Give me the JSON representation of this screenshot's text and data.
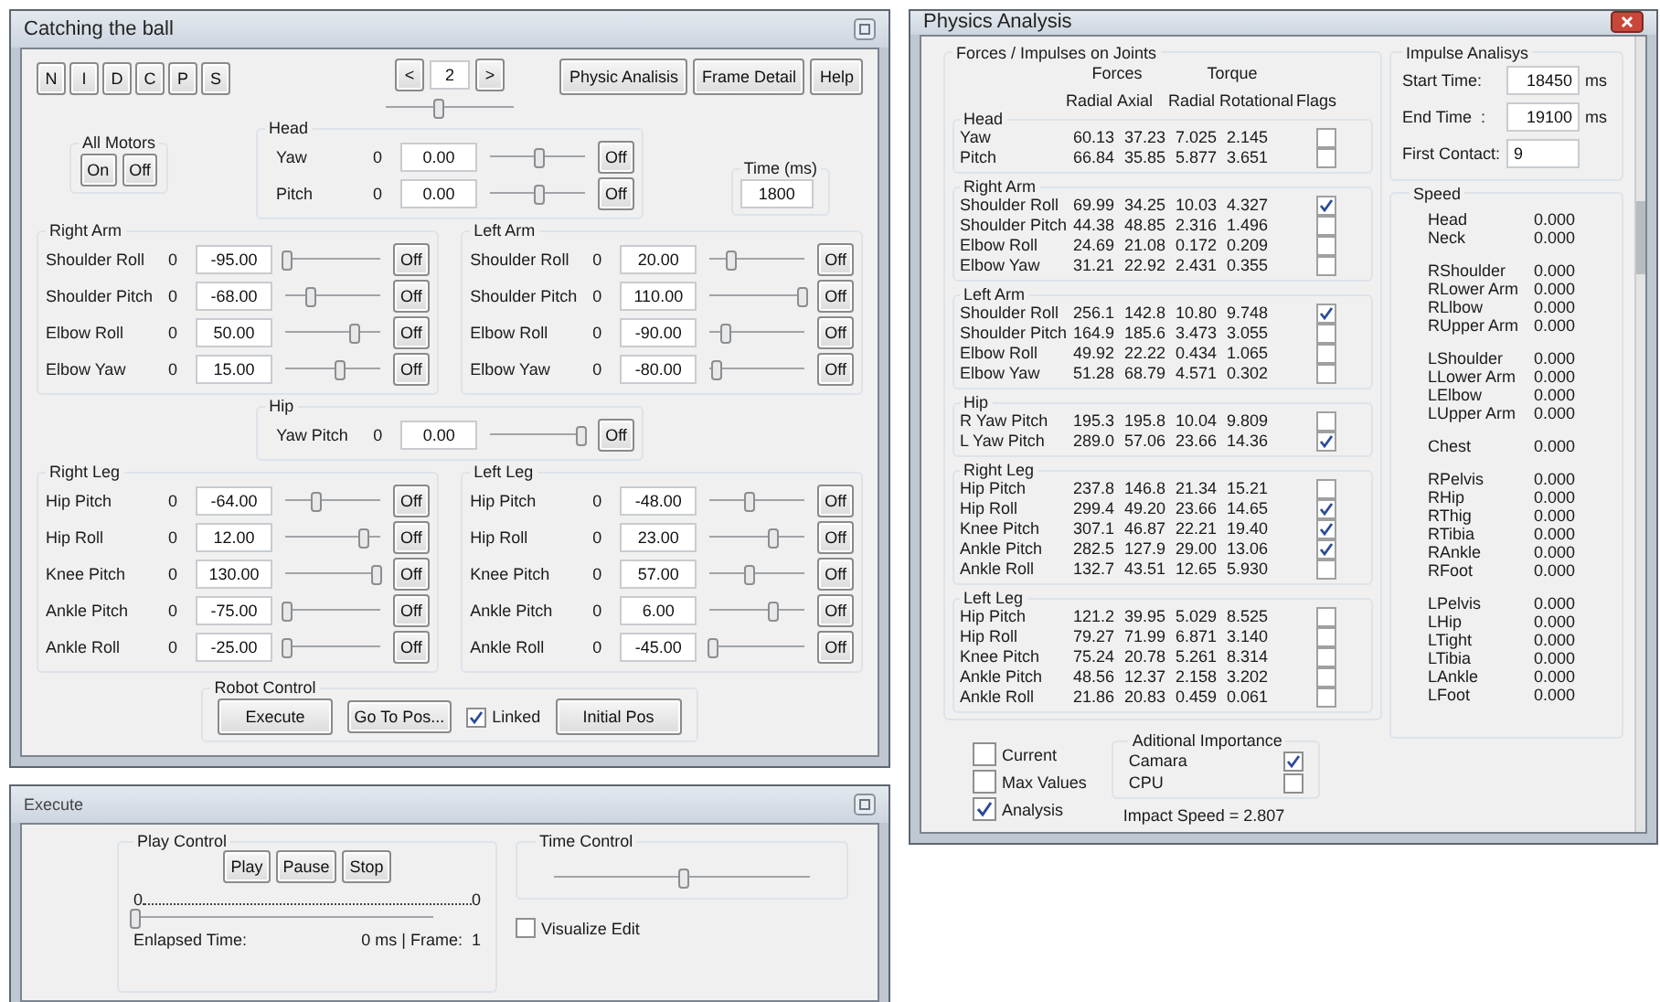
{
  "main_window": {
    "title": "Catching the ball",
    "mode_buttons": [
      "N",
      "I",
      "D",
      "C",
      "P",
      "S"
    ],
    "frame": {
      "prev": "<",
      "value": "2",
      "next": ">",
      "level": 0.4
    },
    "buttons": [
      "Physic Analisis",
      "Frame Detail",
      "Help"
    ],
    "all_motors": {
      "title": "All Motors",
      "buttons": [
        "On",
        "Off"
      ]
    },
    "time": {
      "title": "Time (ms)",
      "value": "1800"
    },
    "head": {
      "title": "Head",
      "joints": [
        {
          "name": "Yaw",
          "zero": "0",
          "value": "0.00",
          "level": 0.5,
          "button": "Off"
        },
        {
          "name": "Pitch",
          "zero": "0",
          "value": "0.00",
          "level": 0.5,
          "button": "Off"
        }
      ]
    },
    "right_arm": {
      "title": "Right Arm",
      "joints": [
        {
          "name": "Shoulder Roll",
          "zero": "0",
          "value": "-95.00",
          "level": 0.0,
          "button": "Off"
        },
        {
          "name": "Shoulder Pitch",
          "zero": "0",
          "value": "-68.00",
          "level": 0.25,
          "button": "Off"
        },
        {
          "name": "Elbow Roll",
          "zero": "0",
          "value": "50.00",
          "level": 0.72,
          "button": "Off"
        },
        {
          "name": "Elbow Yaw",
          "zero": "0",
          "value": "15.00",
          "level": 0.55,
          "button": "Off"
        }
      ]
    },
    "left_arm": {
      "title": "Left Arm",
      "joints": [
        {
          "name": "Shoulder Roll",
          "zero": "0",
          "value": "20.00",
          "level": 0.2,
          "button": "Off"
        },
        {
          "name": "Shoulder Pitch",
          "zero": "0",
          "value": "110.00",
          "level": 0.95,
          "button": "Off"
        },
        {
          "name": "Elbow Roll",
          "zero": "0",
          "value": "-90.00",
          "level": 0.15,
          "button": "Off"
        },
        {
          "name": "Elbow Yaw",
          "zero": "0",
          "value": "-80.00",
          "level": 0.05,
          "button": "Off"
        }
      ]
    },
    "hip": {
      "title": "Hip",
      "joints": [
        {
          "name": "Yaw Pitch",
          "zero": "0",
          "value": "0.00",
          "level": 0.95,
          "button": "Off"
        }
      ]
    },
    "right_leg": {
      "title": "Right Leg",
      "joints": [
        {
          "name": "Hip Pitch",
          "zero": "0",
          "value": "-64.00",
          "level": 0.3,
          "button": "Off"
        },
        {
          "name": "Hip Roll",
          "zero": "0",
          "value": "12.00",
          "level": 0.8,
          "button": "Off"
        },
        {
          "name": "Knee Pitch",
          "zero": "0",
          "value": "130.00",
          "level": 0.95,
          "button": "Off"
        },
        {
          "name": "Ankle Pitch",
          "zero": "0",
          "value": "-75.00",
          "level": 0.0,
          "button": "Off"
        },
        {
          "name": "Ankle Roll",
          "zero": "0",
          "value": "-25.00",
          "level": 0.0,
          "button": "Off"
        }
      ]
    },
    "left_leg": {
      "title": "Left Leg",
      "joints": [
        {
          "name": "Hip Pitch",
          "zero": "0",
          "value": "-48.00",
          "level": 0.4,
          "button": "Off"
        },
        {
          "name": "Hip Roll",
          "zero": "0",
          "value": "23.00",
          "level": 0.65,
          "button": "Off"
        },
        {
          "name": "Knee Pitch",
          "zero": "0",
          "value": "57.00",
          "level": 0.4,
          "button": "Off"
        },
        {
          "name": "Ankle Pitch",
          "zero": "0",
          "value": "6.00",
          "level": 0.65,
          "button": "Off"
        },
        {
          "name": "Ankle Roll",
          "zero": "0",
          "value": "-45.00",
          "level": 0.02,
          "button": "Off"
        }
      ]
    },
    "robot_control": {
      "title": "Robot Control",
      "execute": "Execute",
      "go_to": "Go To Pos...",
      "linked": {
        "label": "Linked",
        "checked": true
      },
      "initial": "Initial Pos"
    }
  },
  "execute_window": {
    "title": "Execute",
    "play_control": {
      "title": "Play Control",
      "buttons": [
        "Play",
        "Pause",
        "Stop"
      ],
      "range_min": "0",
      "range_max": "0",
      "level": 0.0,
      "elapsed_label": "Enlapsed Time:",
      "elapsed_value": "0 ms | Frame:  1"
    },
    "time_control": {
      "title": "Time Control",
      "level": 0.5
    },
    "visualize": {
      "label": "Visualize Edit",
      "checked": false
    }
  },
  "physics_window": {
    "title": "Physics Analysis",
    "forces": {
      "title": "Forces / Impulses on Joints",
      "group_headers": [
        "Forces",
        "Torque"
      ],
      "columns": [
        "Radial",
        "Axial",
        "Radial",
        "Rotational",
        "Flags"
      ],
      "groups": [
        {
          "title": "Head",
          "rows": [
            {
              "name": "Yaw",
              "values": [
                "60.13",
                "37.23",
                "7.025",
                "2.145"
              ],
              "flag": false
            },
            {
              "name": "Pitch",
              "values": [
                "66.84",
                "35.85",
                "5.877",
                "3.651"
              ],
              "flag": false
            }
          ]
        },
        {
          "title": "Right Arm",
          "rows": [
            {
              "name": "Shoulder Roll",
              "values": [
                "69.99",
                "34.25",
                "10.03",
                "4.327"
              ],
              "flag": true
            },
            {
              "name": "Shoulder Pitch",
              "values": [
                "44.38",
                "48.85",
                "2.316",
                "1.496"
              ],
              "flag": false
            },
            {
              "name": "Elbow Roll",
              "values": [
                "24.69",
                "21.08",
                "0.172",
                "0.209"
              ],
              "flag": false
            },
            {
              "name": "Elbow Yaw",
              "values": [
                "31.21",
                "22.92",
                "2.431",
                "0.355"
              ],
              "flag": false
            }
          ]
        },
        {
          "title": "Left Arm",
          "rows": [
            {
              "name": "Shoulder Roll",
              "values": [
                "256.1",
                "142.8",
                "10.80",
                "9.748"
              ],
              "flag": true
            },
            {
              "name": "Shoulder Pitch",
              "values": [
                "164.9",
                "185.6",
                "3.473",
                "3.055"
              ],
              "flag": false
            },
            {
              "name": "Elbow Roll",
              "values": [
                "49.92",
                "22.22",
                "0.434",
                "1.065"
              ],
              "flag": false
            },
            {
              "name": "Elbow Yaw",
              "values": [
                "51.28",
                "68.79",
                "4.571",
                "0.302"
              ],
              "flag": false
            }
          ]
        },
        {
          "title": "Hip",
          "rows": [
            {
              "name": "R Yaw Pitch",
              "values": [
                "195.3",
                "195.8",
                "10.04",
                "9.809"
              ],
              "flag": false
            },
            {
              "name": "L Yaw Pitch",
              "values": [
                "289.0",
                "57.06",
                "23.66",
                "14.36"
              ],
              "flag": true
            }
          ]
        },
        {
          "title": "Right Leg",
          "rows": [
            {
              "name": "Hip Pitch",
              "values": [
                "237.8",
                "146.8",
                "21.34",
                "15.21"
              ],
              "flag": false
            },
            {
              "name": "Hip Roll",
              "values": [
                "299.4",
                "49.20",
                "23.66",
                "14.65"
              ],
              "flag": true
            },
            {
              "name": "Knee Pitch",
              "values": [
                "307.1",
                "46.87",
                "22.21",
                "19.40"
              ],
              "flag": true
            },
            {
              "name": "Ankle Pitch",
              "values": [
                "282.5",
                "127.9",
                "29.00",
                "13.06"
              ],
              "flag": true
            },
            {
              "name": "Ankle Roll",
              "values": [
                "132.7",
                "43.51",
                "12.65",
                "5.930"
              ],
              "flag": false
            }
          ]
        },
        {
          "title": "Left Leg",
          "rows": [
            {
              "name": "Hip Pitch",
              "values": [
                "121.2",
                "39.95",
                "5.029",
                "8.525"
              ],
              "flag": false
            },
            {
              "name": "Hip Roll",
              "values": [
                "79.27",
                "71.99",
                "6.871",
                "3.140"
              ],
              "flag": false
            },
            {
              "name": "Knee Pitch",
              "values": [
                "75.24",
                "20.78",
                "5.261",
                "8.314"
              ],
              "flag": false
            },
            {
              "name": "Ankle Pitch",
              "values": [
                "48.56",
                "12.37",
                "2.158",
                "3.202"
              ],
              "flag": false
            },
            {
              "name": "Ankle Roll",
              "values": [
                "21.86",
                "20.83",
                "0.459",
                "0.061"
              ],
              "flag": false
            }
          ]
        }
      ]
    },
    "options": [
      {
        "label": "Current",
        "checked": false
      },
      {
        "label": "Max Values",
        "checked": false
      },
      {
        "label": "Analysis",
        "checked": true
      }
    ],
    "importance": {
      "title": "Aditional Importance",
      "items": [
        {
          "label": "Camara",
          "checked": true
        },
        {
          "label": "CPU",
          "checked": false
        }
      ]
    },
    "impact_speed": "Impact Speed = 2.807",
    "impulse": {
      "title": "Impulse Analisys",
      "fields": [
        {
          "label": "Start Time:",
          "value": "18450",
          "unit": "ms"
        },
        {
          "label": "End Time  :",
          "value": "19100",
          "unit": "ms"
        },
        {
          "label": "First Contact:",
          "value": "9"
        }
      ]
    },
    "speed": {
      "title": "Speed",
      "groups": [
        [
          {
            "name": "Head",
            "value": "0.000"
          },
          {
            "name": "Neck",
            "value": "0.000"
          }
        ],
        [
          {
            "name": "RShoulder",
            "value": "0.000"
          },
          {
            "name": "RLower Arm",
            "value": "0.000"
          },
          {
            "name": "RLlbow",
            "value": "0.000"
          },
          {
            "name": "RUpper Arm",
            "value": "0.000"
          }
        ],
        [
          {
            "name": "LShoulder",
            "value": "0.000"
          },
          {
            "name": "LLower Arm",
            "value": "0.000"
          },
          {
            "name": "LElbow",
            "value": "0.000"
          },
          {
            "name": "LUpper Arm",
            "value": "0.000"
          }
        ],
        [
          {
            "name": "Chest",
            "value": "0.000"
          }
        ],
        [
          {
            "name": "RPelvis",
            "value": "0.000"
          },
          {
            "name": "RHip",
            "value": "0.000"
          },
          {
            "name": "RThig",
            "value": "0.000"
          },
          {
            "name": "RTibia",
            "value": "0.000"
          },
          {
            "name": "RAnkle",
            "value": "0.000"
          },
          {
            "name": "RFoot",
            "value": "0.000"
          }
        ],
        [
          {
            "name": "LPelvis",
            "value": "0.000"
          },
          {
            "name": "LHip",
            "value": "0.000"
          },
          {
            "name": "LTight",
            "value": "0.000"
          },
          {
            "name": "LTibia",
            "value": "0.000"
          },
          {
            "name": "LAnkle",
            "value": "0.000"
          },
          {
            "name": "LFoot",
            "value": "0.000"
          }
        ]
      ]
    }
  }
}
